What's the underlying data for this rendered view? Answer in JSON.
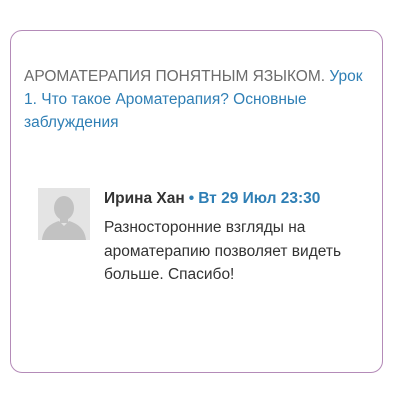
{
  "post": {
    "title_prefix": "АРОМАТЕРАПИЯ ПОНЯТНЫМ ЯЗЫКОМ.",
    "title_link": "Урок 1. Что такое Ароматерапия? Основные заблуждения"
  },
  "comment": {
    "avatar_icon": "user-silhouette-icon",
    "author": "Ирина Хан",
    "separator": "•",
    "date": "Вт 29 Июл 23:30",
    "text": "Разносторонние взгляды на ароматерапию позволяет видеть больше. Спасибо!"
  },
  "colors": {
    "card_border": "#b48bb8",
    "link": "#2f7fb5",
    "muted_text": "#6b6b6b",
    "body_text": "#333333"
  }
}
